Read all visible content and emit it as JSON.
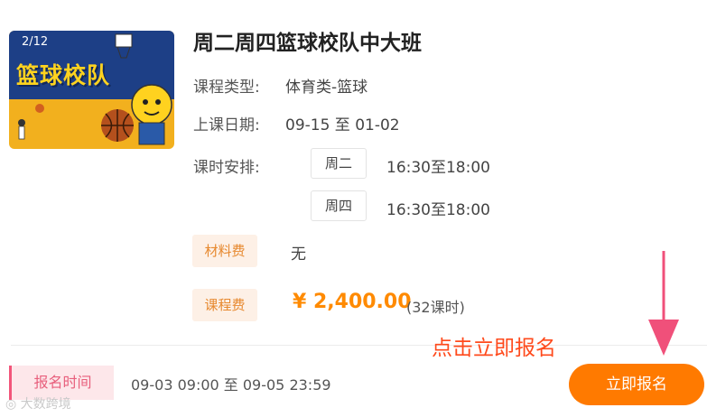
{
  "course": {
    "thumbnail": {
      "page_indicator": "2/12",
      "title": "篮球校队"
    },
    "title": "周二周四篮球校队中大班",
    "type_label": "课程类型:",
    "type_value": "体育类-篮球",
    "date_label": "上课日期:",
    "date_value": "09-15 至 01-02",
    "schedule_label": "课时安排:",
    "schedule": [
      {
        "day": "周二",
        "time": "16:30至18:00"
      },
      {
        "day": "周四",
        "time": "16:30至18:00"
      }
    ],
    "material_fee_label": "材料费",
    "material_fee_value": "无",
    "course_fee_label": "课程费",
    "course_fee_value": "¥ 2,400.00",
    "course_fee_note": "(32课时)"
  },
  "footer": {
    "enroll_time_label": "报名时间",
    "enroll_time_value": "09-03 09:00 至 09-05 23:59",
    "enroll_button_label": "立即报名"
  },
  "annotation": {
    "hint_text": "点击立即报名"
  },
  "watermark": {
    "text": "大数跨境"
  },
  "colors": {
    "accent": "#ff7a00",
    "annotation_red": "#ff4a1c",
    "enroll_label_pink": "#e85f7c",
    "tag_orange": "#e7892f"
  }
}
